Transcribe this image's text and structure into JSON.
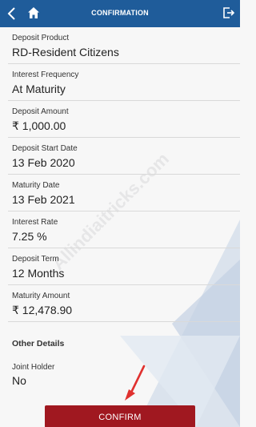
{
  "header": {
    "title": "CONFIRMATION",
    "back_icon": "chevron-left-icon",
    "home_icon": "home-icon",
    "logout_icon": "logout-icon"
  },
  "fields": [
    {
      "label": "Deposit Product",
      "value": "RD-Resident Citizens"
    },
    {
      "label": "Interest Frequency",
      "value": "At Maturity"
    },
    {
      "label": "Deposit Amount",
      "value": "₹ 1,000.00"
    },
    {
      "label": "Deposit Start Date",
      "value": "13 Feb 2020"
    },
    {
      "label": "Maturity Date",
      "value": "13 Feb 2021"
    },
    {
      "label": "Interest Rate",
      "value": "7.25 %"
    },
    {
      "label": "Deposit Term",
      "value": "12 Months"
    },
    {
      "label": "Maturity Amount",
      "value": "₹ 12,478.90"
    }
  ],
  "other_details": {
    "title": "Other Details",
    "joint_holder_label": "Joint Holder",
    "joint_holder_value": "No"
  },
  "watermark": "Allindiaitricks.com",
  "confirm_label": "CONFIRM",
  "colors": {
    "header": "#1f5c9a",
    "confirm_button": "#a01820",
    "arrow": "#e0312f"
  }
}
